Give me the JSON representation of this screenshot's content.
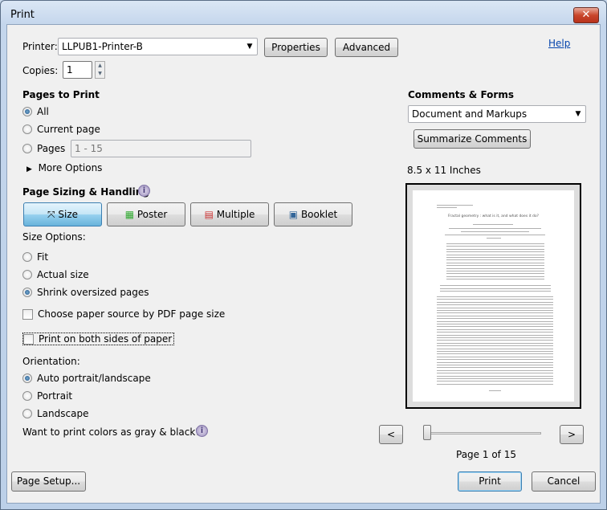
{
  "window": {
    "title": "Print",
    "close": "✕"
  },
  "printer": {
    "label": "Printer:",
    "value": "LLPUB1-Printer-B",
    "properties": "Properties",
    "advanced": "Advanced",
    "help": "Help"
  },
  "copies": {
    "label": "Copies:",
    "value": "1"
  },
  "pages": {
    "heading": "Pages to Print",
    "all": "All",
    "current": "Current page",
    "pages": "Pages",
    "range": "1 - 15",
    "more": "More Options",
    "selected": "All"
  },
  "sizing": {
    "heading": "Page Sizing & Handling",
    "tabs": [
      "Size",
      "Poster",
      "Multiple",
      "Booklet"
    ],
    "selected": "Size",
    "options_label": "Size Options:",
    "fit": "Fit",
    "actual": "Actual size",
    "shrink": "Shrink oversized pages",
    "selected_option": "Shrink oversized pages",
    "paper_source": "Choose paper source by PDF page size",
    "both_sides": "Print on both sides of paper"
  },
  "orientation": {
    "label": "Orientation:",
    "auto": "Auto portrait/landscape",
    "portrait": "Portrait",
    "landscape": "Landscape",
    "selected": "Auto portrait/landscape"
  },
  "gray": {
    "label": "Want to print colors as gray & black?"
  },
  "comments": {
    "heading": "Comments & Forms",
    "value": "Document and Markups",
    "summarize": "Summarize Comments"
  },
  "preview": {
    "size": "8.5 x 11 Inches",
    "doc_title": "Fractal geometry : what is it, and what does it do?",
    "prev": "<",
    "next": ">",
    "page_label": "Page 1 of 15",
    "slider_fraction": 0
  },
  "footer": {
    "page_setup": "Page Setup...",
    "print": "Print",
    "cancel": "Cancel"
  }
}
